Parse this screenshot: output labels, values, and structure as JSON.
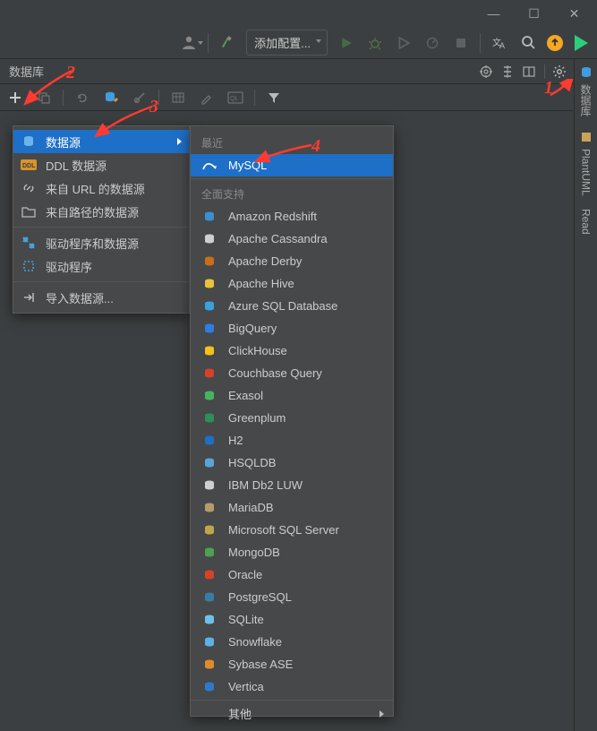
{
  "window": {
    "minimize_glyph": "—",
    "maximize_glyph": "☐",
    "close_glyph": "✕"
  },
  "main_toolbar": {
    "config_label": "添加配置..."
  },
  "panel": {
    "title": "数据库"
  },
  "right_gutter": {
    "items": [
      {
        "label": "数据库"
      },
      {
        "label": "PlantUML"
      },
      {
        "label": "Read"
      }
    ]
  },
  "menu1": {
    "items": [
      {
        "label": "数据源",
        "selected": true,
        "has_submenu": true
      },
      {
        "label": "DDL 数据源"
      },
      {
        "label": "来自 URL 的数据源"
      },
      {
        "label": "来自路径的数据源"
      },
      {
        "label": "驱动程序和数据源"
      },
      {
        "label": "驱动程序"
      },
      {
        "label": "导入数据源..."
      }
    ]
  },
  "menu2": {
    "recent_header": "最近",
    "recent": [
      {
        "label": "MySQL",
        "selected": true
      }
    ],
    "full_support_header": "全面支持",
    "full_support": [
      {
        "label": "Amazon Redshift",
        "color": "#3b8fd1"
      },
      {
        "label": "Apache Cassandra",
        "color": "#cfcfcf"
      },
      {
        "label": "Apache Derby",
        "color": "#c96e1b"
      },
      {
        "label": "Apache Hive",
        "color": "#e8c33b"
      },
      {
        "label": "Azure SQL Database",
        "color": "#3aa0e0"
      },
      {
        "label": "BigQuery",
        "color": "#2f7de0"
      },
      {
        "label": "ClickHouse",
        "color": "#f3c21a"
      },
      {
        "label": "Couchbase Query",
        "color": "#d34229"
      },
      {
        "label": "Exasol",
        "color": "#49b25f"
      },
      {
        "label": "Greenplum",
        "color": "#2f8f5a"
      },
      {
        "label": "H2",
        "color": "#1e6fc7"
      },
      {
        "label": "HSQLDB",
        "color": "#5aa3d6"
      },
      {
        "label": "IBM Db2 LUW",
        "color": "#cfcfcf"
      },
      {
        "label": "MariaDB",
        "color": "#b59a6d"
      },
      {
        "label": "Microsoft SQL Server",
        "color": "#bfa64c"
      },
      {
        "label": "MongoDB",
        "color": "#4ea24e"
      },
      {
        "label": "Oracle",
        "color": "#d34229"
      },
      {
        "label": "PostgreSQL",
        "color": "#3b7aa1"
      },
      {
        "label": "SQLite",
        "color": "#6ec0e8"
      },
      {
        "label": "Snowflake",
        "color": "#5db1e6"
      },
      {
        "label": "Sybase ASE",
        "color": "#e08b2a"
      },
      {
        "label": "Vertica",
        "color": "#3178c6"
      }
    ],
    "other_label": "其他"
  },
  "annotations": {
    "n1": "1",
    "n2": "2",
    "n3": "3",
    "n4": "4"
  }
}
